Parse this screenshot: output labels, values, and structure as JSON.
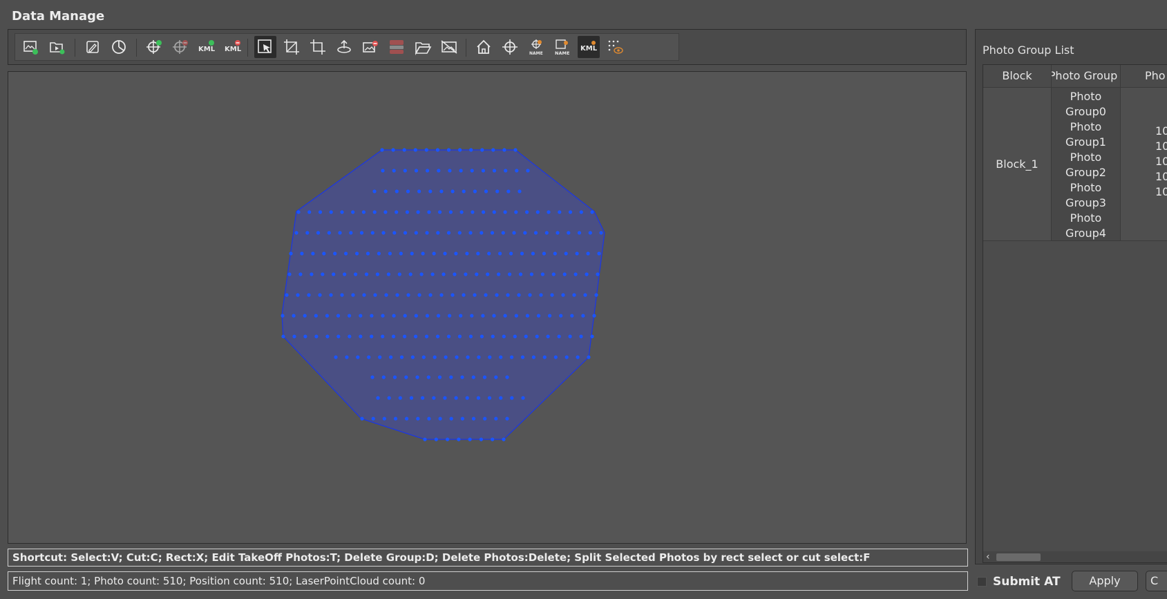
{
  "window": {
    "title": "Data Manage"
  },
  "toolbar": {
    "buttons": [
      {
        "name": "import-photos-icon",
        "label": ""
      },
      {
        "name": "import-video-icon",
        "label": ""
      },
      {
        "name": "edit-photo-icon",
        "label": ""
      },
      {
        "name": "pie-chart-icon",
        "label": ""
      },
      {
        "name": "add-gcp-icon",
        "label": ""
      },
      {
        "name": "remove-gcp-icon",
        "label": ""
      },
      {
        "name": "import-kml-icon",
        "label": "KML"
      },
      {
        "name": "remove-kml-icon",
        "label": "KML"
      },
      {
        "name": "select-cursor-icon",
        "label": ""
      },
      {
        "name": "crop-rect-icon",
        "label": ""
      },
      {
        "name": "crop-icon",
        "label": ""
      },
      {
        "name": "takeoff-icon",
        "label": ""
      },
      {
        "name": "delete-photos-icon",
        "label": ""
      },
      {
        "name": "split-group-icon",
        "label": ""
      },
      {
        "name": "open-folder-icon",
        "label": ""
      },
      {
        "name": "hide-photos-icon",
        "label": ""
      },
      {
        "name": "home-icon",
        "label": ""
      },
      {
        "name": "crosshair-icon",
        "label": ""
      },
      {
        "name": "show-gcp-name-icon",
        "label": "NAME"
      },
      {
        "name": "show-photo-name-icon",
        "label": "NAME"
      },
      {
        "name": "show-kml-icon",
        "label": "KML"
      },
      {
        "name": "show-points-icon",
        "label": ""
      }
    ]
  },
  "shortcut_text": "Shortcut: Select:V; Cut:C; Rect:X; Edit TakeOff Photos:T; Delete Group:D; Delete Photos:Delete; Split Selected Photos by rect select or cut select:F",
  "status_text": "Flight count: 1; Photo count: 510; Position count: 510; LaserPointCloud count: 0",
  "panel": {
    "title": "Photo Group List",
    "columns": [
      "Block",
      "Photo Group",
      "Pho"
    ],
    "rows": [
      {
        "block": "Block_1",
        "groups": [
          "Photo",
          "Group0",
          "Photo",
          "Group1",
          "Photo",
          "Group2",
          "Photo",
          "Group3",
          "Photo",
          "Group4"
        ],
        "counts": [
          "10",
          "10",
          "10",
          "10",
          "10"
        ]
      }
    ]
  },
  "footer": {
    "submit_label": "Submit AT",
    "submit_checked": false,
    "apply_label": "Apply",
    "cancel_label": "C"
  },
  "map": {
    "fill_color": "#4a4f84",
    "outline_color": "#1a36e6",
    "point_color": "#1a55ff"
  },
  "colors": {
    "background": "#4e4e4e",
    "active_tool": "#2b2b2b",
    "danger": "#e05050",
    "success": "#3cbf5a"
  }
}
